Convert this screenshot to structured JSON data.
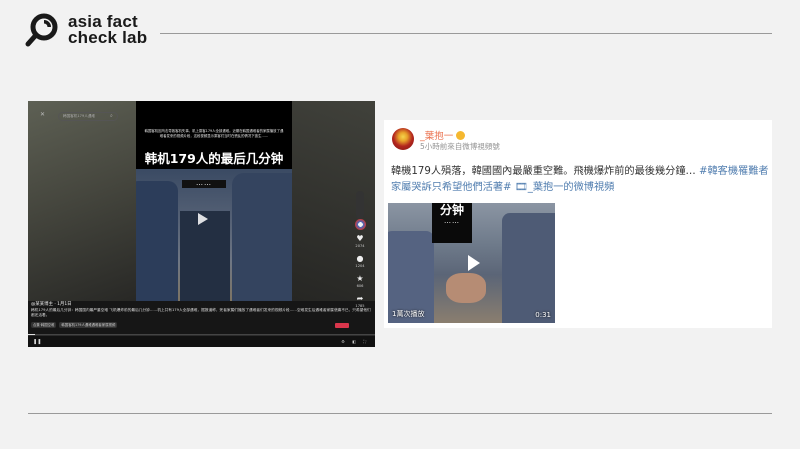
{
  "brand": {
    "line1": "asia fact",
    "line2": "check lab"
  },
  "left_player": {
    "search_placeholder": "韩国客机179人遇难",
    "overlay_text": "韩国客机因鸟击导致客机失事，机上乘客179人全部遇难。近期在韩国遇难者的家属播放了遇难者发来的视频片段，这段视频显示乘客们当时在慌乱的情况下逃生……",
    "video_title": "韩机179人的最后几分钟",
    "video_dots": "……",
    "side_icons": [
      {
        "icon": "heart-icon",
        "count": "2074"
      },
      {
        "icon": "comment-icon",
        "count": "1204"
      },
      {
        "icon": "star-icon",
        "count": "606"
      },
      {
        "icon": "share-icon",
        "count": "1785"
      }
    ],
    "author": "@某某博主",
    "author_date": "· 1月1日",
    "caption": "韩机179人的最后几分钟：韩国国内最严重空难 飞机爆炸前的最后几分钟……机上共有179人全部遇难，据报道称，死者家属们播放了遇难者们发来的视频片段……空难发生后遇难者家属悲痛不已，只希望他们都还活着。",
    "tags": [
      "合集·韩国空难",
      "韩国客机179人遇难遇难者家属视频"
    ],
    "progress": 0.02
  },
  "weibo": {
    "user_name": "_葉抱一",
    "meta": "5小時前來自微博視頻號",
    "text_main": "韓機179人殞落，韓國國內最嚴重空難。飛機爆炸前的最後幾分鐘… ",
    "text_tag1": "#韓客機罹難者家屬哭訴只希望他們活著#",
    "text_tag2": " 🎞_葉抱一的微博視頻",
    "video_title_partial": "分钟",
    "video_dots": "……",
    "views": "1萬次播放",
    "duration": "0:31"
  }
}
